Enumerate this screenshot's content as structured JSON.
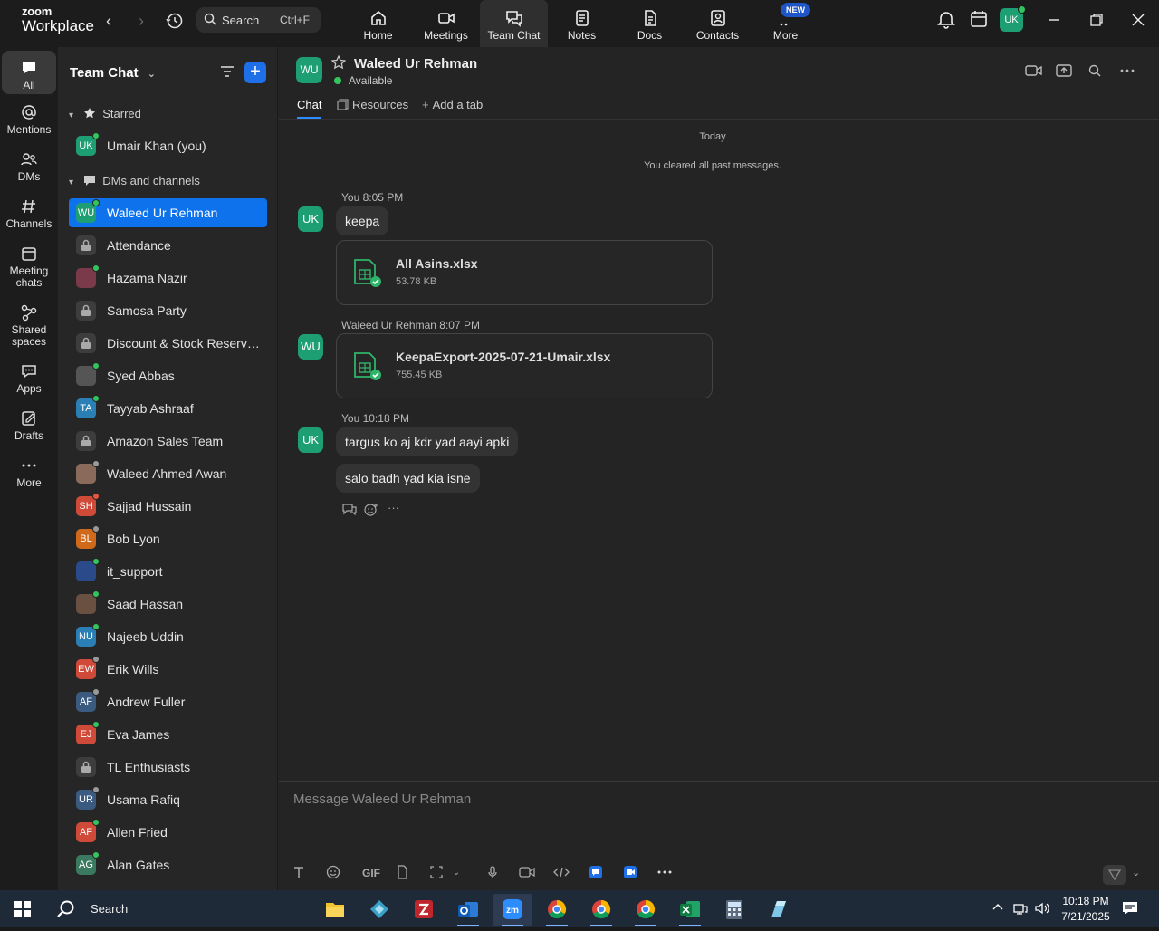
{
  "app": {
    "logo_top": "zoom",
    "logo_bottom": "Workplace"
  },
  "search": {
    "label": "Search",
    "shortcut": "Ctrl+F"
  },
  "top_tabs": [
    {
      "label": "Home",
      "icon": "home-icon"
    },
    {
      "label": "Meetings",
      "icon": "video-camera-icon"
    },
    {
      "label": "Team Chat",
      "icon": "chat-bubbles-icon"
    },
    {
      "label": "Notes",
      "icon": "notes-icon"
    },
    {
      "label": "Docs",
      "icon": "document-icon"
    },
    {
      "label": "Contacts",
      "icon": "contact-card-icon"
    },
    {
      "label": "More",
      "icon": "more-dots-icon"
    }
  ],
  "new_badge": "NEW",
  "user_avatar": "UK",
  "rail": [
    {
      "label": "All"
    },
    {
      "label": "Mentions"
    },
    {
      "label": "DMs"
    },
    {
      "label": "Channels"
    },
    {
      "label": "Meeting chats"
    },
    {
      "label": "Shared spaces"
    },
    {
      "label": "Apps"
    },
    {
      "label": "Drafts"
    },
    {
      "label": "More"
    }
  ],
  "sidebar": {
    "title": "Team Chat",
    "starred_label": "Starred",
    "dms_label": "DMs and channels",
    "starred": [
      {
        "initials": "UK",
        "name": "Umair Khan (you)",
        "color": "#1e9e73",
        "status": "#33c45e"
      }
    ],
    "items": [
      {
        "initials": "WU",
        "name": "Waleed Ur Rehman",
        "color": "#1e9e73",
        "status": "#33c45e",
        "active": true
      },
      {
        "initials": "",
        "name": "Attendance",
        "lock": true
      },
      {
        "initials": "",
        "name": "Hazama Nazir",
        "color": "#7a3a4a",
        "status": "#33c45e"
      },
      {
        "initials": "",
        "name": "Samosa Party",
        "lock": true
      },
      {
        "initials": "",
        "name": "Discount & Stock Reservati...",
        "lock": true
      },
      {
        "initials": "",
        "name": "Syed Abbas",
        "color": "#555555",
        "status": "#33c45e"
      },
      {
        "initials": "TA",
        "name": "Tayyab Ashraaf",
        "color": "#2a7fb5",
        "status": "#33c45e"
      },
      {
        "initials": "",
        "name": "Amazon Sales Team",
        "lock": true
      },
      {
        "initials": "",
        "name": "Waleed Ahmed Awan",
        "color": "#8a6a5a",
        "status": "#9a9a9a"
      },
      {
        "initials": "SH",
        "name": "Sajjad Hussain",
        "color": "#d04a3a",
        "status": "#e8543f"
      },
      {
        "initials": "BL",
        "name": "Bob Lyon",
        "color": "#d06a1a",
        "status": "#9a9a9a"
      },
      {
        "initials": "",
        "name": "it_support",
        "color": "#2a4a8a",
        "status": "#33c45e"
      },
      {
        "initials": "",
        "name": "Saad Hassan",
        "color": "#6a5040",
        "status": "#33c45e"
      },
      {
        "initials": "NU",
        "name": "Najeeb Uddin",
        "color": "#2a7fb5",
        "status": "#33c45e"
      },
      {
        "initials": "EW",
        "name": "Erik Wills",
        "color": "#d04a3a",
        "status": "#9a9a9a"
      },
      {
        "initials": "AF",
        "name": "Andrew Fuller",
        "color": "#3a5a80",
        "status": "#9a9a9a"
      },
      {
        "initials": "EJ",
        "name": "Eva James",
        "color": "#d04a3a",
        "status": "#33c45e"
      },
      {
        "initials": "",
        "name": "TL Enthusiasts",
        "lock": true
      },
      {
        "initials": "UR",
        "name": "Usama Rafiq",
        "color": "#3a5a80",
        "status": "#9a9a9a"
      },
      {
        "initials": "AF",
        "name": "Allen Fried",
        "color": "#d04a3a",
        "status": "#33c45e"
      },
      {
        "initials": "AG",
        "name": "Alan Gates",
        "color": "#3a7a60",
        "status": "#33c45e"
      }
    ]
  },
  "chat": {
    "avatar": "WU",
    "name": "Waleed Ur Rehman",
    "status": "Available",
    "tabs": [
      "Chat",
      "Resources",
      "Add a tab"
    ],
    "day_label": "Today",
    "cleared": "You cleared all past messages.",
    "messages": [
      {
        "avatar": "UK",
        "meta": "You 8:05 PM",
        "text": "keepa",
        "file_name": "All Asins.xlsx",
        "file_size": "53.78 KB"
      },
      {
        "avatar": "WU",
        "meta": "Waleed Ur Rehman 8:07 PM",
        "file_name": "KeepaExport-2025-07-21-Umair.xlsx",
        "file_size": "755.45 KB"
      },
      {
        "avatar": "UK",
        "meta": "You 10:18 PM",
        "text1": "targus ko aj kdr yad aayi apki",
        "text2": "salo badh yad kia isne"
      }
    ],
    "composer_placeholder": "Message Waleed Ur Rehman",
    "gif_label": "GIF"
  },
  "taskbar": {
    "search_label": "Search",
    "time": "10:18 PM",
    "date": "7/21/2025"
  },
  "colors": {
    "accent": "#0e72ed",
    "brand_green": "#1e9e73",
    "online": "#33c45e"
  }
}
